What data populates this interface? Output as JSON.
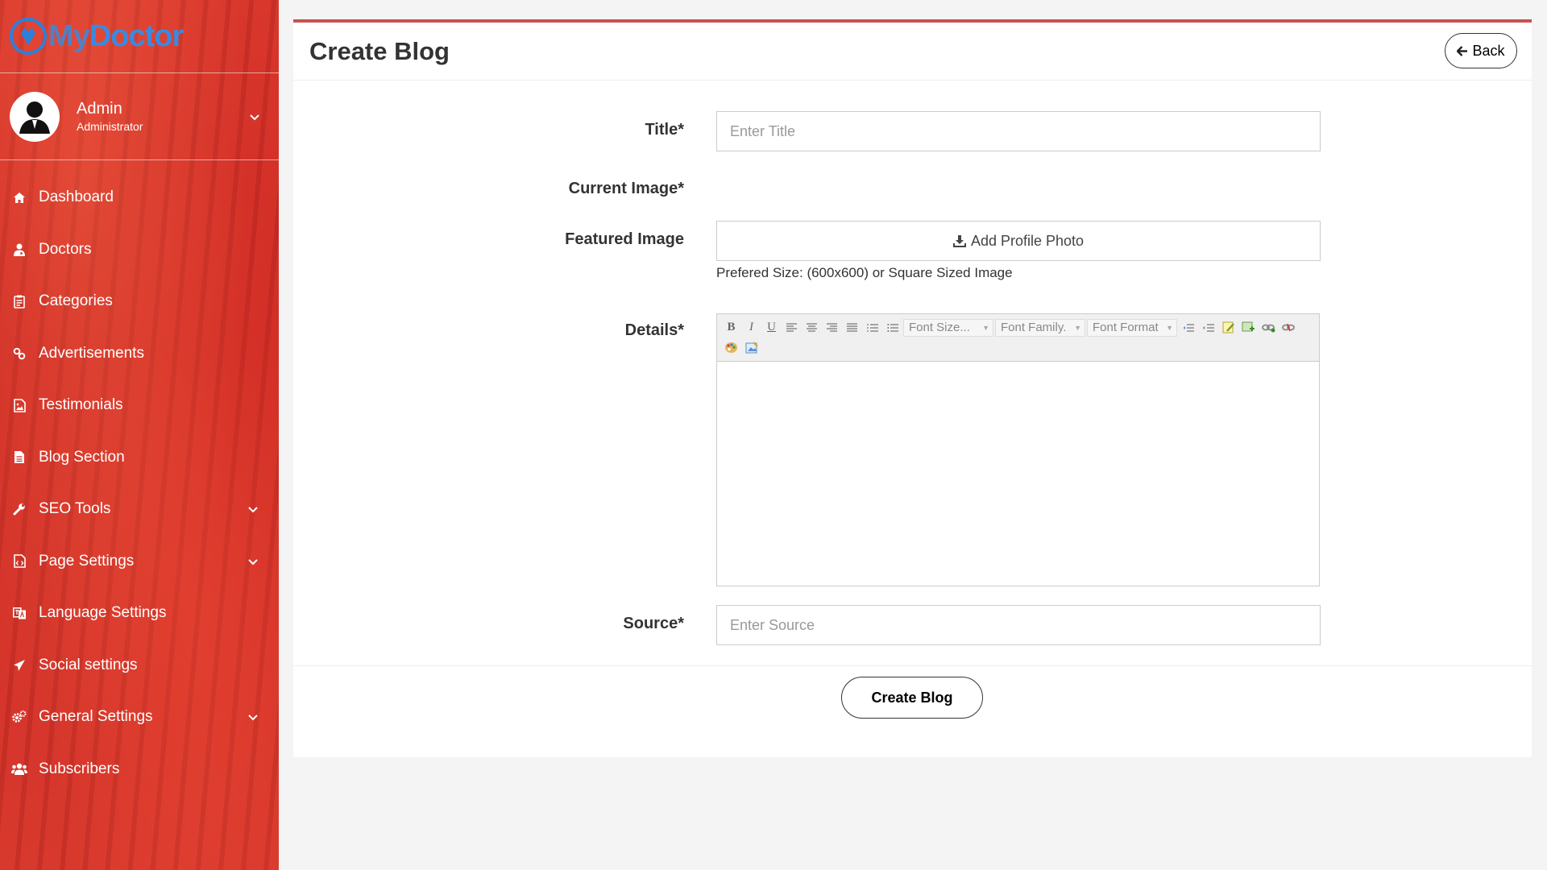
{
  "brand": {
    "part1": "My",
    "part2": "Doctor"
  },
  "user": {
    "name": "Admin",
    "role": "Administrator"
  },
  "sidebar": {
    "items": [
      {
        "label": "Dashboard",
        "icon": "home-icon",
        "has_submenu": false
      },
      {
        "label": "Doctors",
        "icon": "user-md-icon",
        "has_submenu": false
      },
      {
        "label": "Categories",
        "icon": "clipboard-icon",
        "has_submenu": false
      },
      {
        "label": "Advertisements",
        "icon": "link-icon",
        "has_submenu": false
      },
      {
        "label": "Testimonials",
        "icon": "image-icon",
        "has_submenu": false
      },
      {
        "label": "Blog Section",
        "icon": "file-icon",
        "has_submenu": false
      },
      {
        "label": "SEO Tools",
        "icon": "wrench-icon",
        "has_submenu": true
      },
      {
        "label": "Page Settings",
        "icon": "file-code-icon",
        "has_submenu": true
      },
      {
        "label": "Language Settings",
        "icon": "language-icon",
        "has_submenu": false
      },
      {
        "label": "Social settings",
        "icon": "paper-plane-icon",
        "has_submenu": false
      },
      {
        "label": "General Settings",
        "icon": "cogs-icon",
        "has_submenu": true
      },
      {
        "label": "Subscribers",
        "icon": "users-icon",
        "has_submenu": false
      }
    ]
  },
  "page": {
    "title": "Create Blog",
    "back_label": "Back"
  },
  "form": {
    "title_label": "Title*",
    "title_placeholder": "Enter Title",
    "current_image_label": "Current Image*",
    "featured_label": "Featured Image",
    "upload_label": "Add Profile Photo",
    "upload_hint": "Prefered Size: (600x600) or Square Sized Image",
    "details_label": "Details*",
    "editor": {
      "font_size": "Font Size...",
      "font_family": "Font Family.",
      "font_format": "Font Format"
    },
    "source_label": "Source*",
    "source_placeholder": "Enter Source",
    "submit_label": "Create Blog"
  },
  "colors": {
    "sidebar": "#d23329",
    "accent_border": "#c9514d",
    "brand_blue": "#3a8ae0"
  }
}
